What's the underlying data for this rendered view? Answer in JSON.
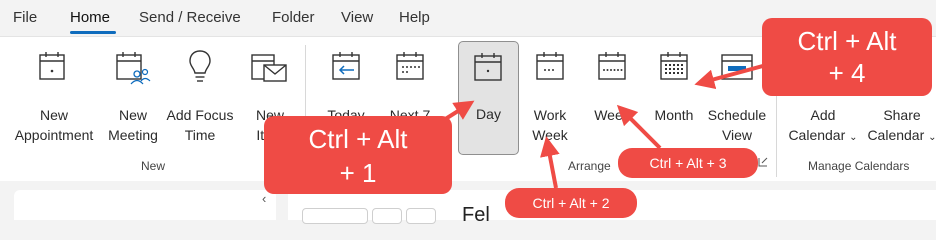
{
  "menubar": {
    "tabs": [
      {
        "label": "File"
      },
      {
        "label": "Home"
      },
      {
        "label": "Send / Receive"
      },
      {
        "label": "Folder"
      },
      {
        "label": "View"
      },
      {
        "label": "Help"
      }
    ],
    "active_tab": "Home"
  },
  "ribbon": {
    "new_group": {
      "label": "New",
      "buttons": [
        {
          "line1": "New",
          "line2": "Appointment",
          "icon": "calendar-dot-icon"
        },
        {
          "line1": "New",
          "line2": "Meeting",
          "icon": "calendar-people-icon"
        },
        {
          "line1": "Add Focus",
          "line2": "Time",
          "icon": "lightbulb-icon"
        },
        {
          "line1": "New",
          "line2": "Item",
          "icon": "envelope-icon"
        }
      ]
    },
    "arrange_group": {
      "label": "Arrange",
      "buttons": [
        {
          "line1": "Today",
          "icon": "calendar-arrow-icon"
        },
        {
          "line1": "Next 7",
          "icon": "calendar-week-icon"
        },
        {
          "line1": "Day",
          "icon": "calendar-day-icon",
          "selected": true
        },
        {
          "line1": "Work",
          "line2": "Week",
          "icon": "calendar-workweek-icon"
        },
        {
          "line1": "Week",
          "icon": "calendar-fullweek-icon"
        },
        {
          "line1": "Month",
          "icon": "calendar-month-icon"
        },
        {
          "line1": "Schedule",
          "line2": "View",
          "icon": "schedule-view-icon"
        }
      ]
    },
    "manage_group": {
      "label": "Manage Calendars",
      "buttons": [
        {
          "line1": "Add",
          "line2": "Calendar",
          "dropdown": true,
          "icon": "add-calendar-icon"
        },
        {
          "line1": "Share",
          "line2": "Calendar",
          "dropdown": true,
          "icon": "share-calendar-icon"
        }
      ]
    }
  },
  "lower": {
    "collapse_glyph": "‹",
    "title_fragment": "Fel"
  },
  "annotations": [
    {
      "text_line1": "Ctrl + Alt",
      "text_line2": "+ 1"
    },
    {
      "text": "Ctrl + Alt + 2"
    },
    {
      "text": "Ctrl + Alt + 3"
    },
    {
      "text_line1": "Ctrl + Alt",
      "text_line2": "+ 4"
    }
  ],
  "colors": {
    "accent": "#0f6cbd",
    "callout": "#ef4b45"
  }
}
